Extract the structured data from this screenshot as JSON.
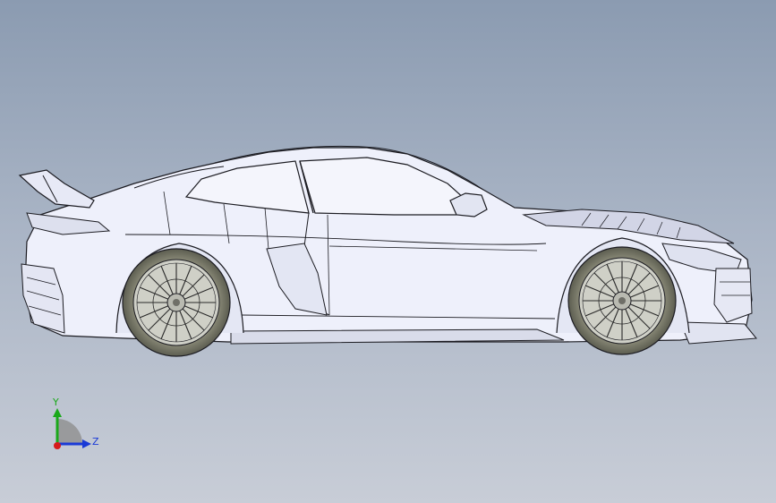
{
  "triad": {
    "y_label": "Y",
    "z_label": "Z",
    "colors": {
      "y": "#1aa81a",
      "z": "#1a3ad6",
      "x": "#d61a1a"
    }
  },
  "model": {
    "body_color": "#eef0fb",
    "edge_color": "#1c1c22",
    "tire_color": "#6e6f5f",
    "rim_color": "#cfd0c7"
  }
}
